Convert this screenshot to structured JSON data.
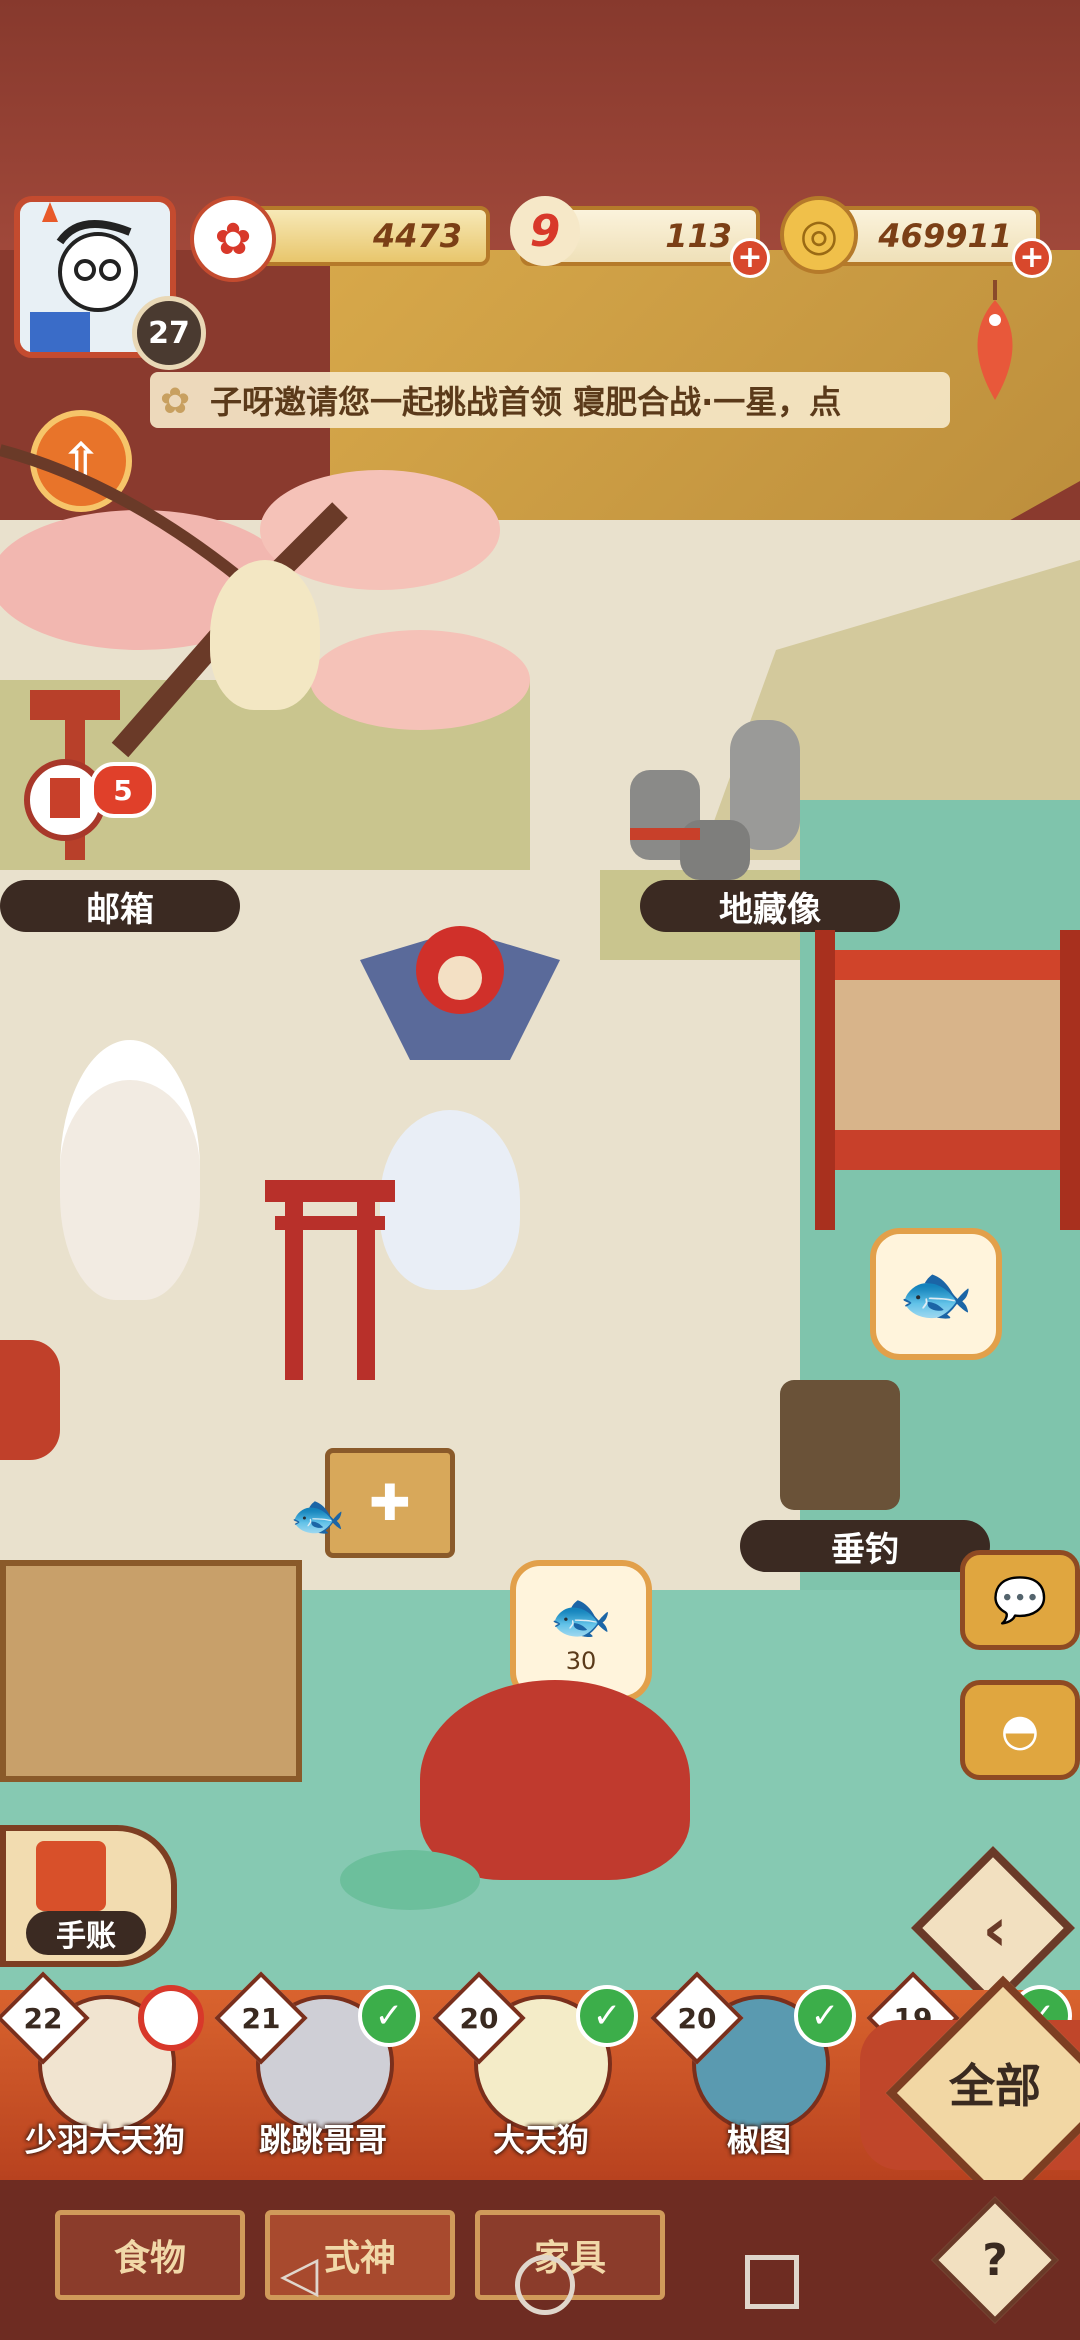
{
  "player": {
    "level": "27"
  },
  "resources": [
    {
      "name": "plum-coin",
      "value": "4473",
      "icon": "✿",
      "color": "#d8382a"
    },
    {
      "name": "ticket",
      "value": "113",
      "icon": "9",
      "color": "#d8382a"
    },
    {
      "name": "gold-coin",
      "value": "469911",
      "icon": "◎",
      "color": "#e0a030"
    }
  ],
  "banner": {
    "text": "子呀邀请您一起挑战首领 寝肥合战·一星，点"
  },
  "map": {
    "mailbox_label": "邮箱",
    "mailbox_count": "5",
    "jizo_label": "地藏像",
    "fishing_label": "垂钓",
    "bait_count": "30"
  },
  "handbook_label": "手账",
  "roster": [
    {
      "level": "22",
      "name": "少羽大天狗",
      "checked": false
    },
    {
      "level": "21",
      "name": "跳跳哥哥",
      "checked": true
    },
    {
      "level": "20",
      "name": "大天狗",
      "checked": true
    },
    {
      "level": "20",
      "name": "椒图",
      "checked": true
    },
    {
      "level": "19",
      "name": "",
      "checked": true
    }
  ],
  "all_label": "全部",
  "tabs": [
    "食物",
    "式神",
    "家具"
  ],
  "help_icon": "?"
}
